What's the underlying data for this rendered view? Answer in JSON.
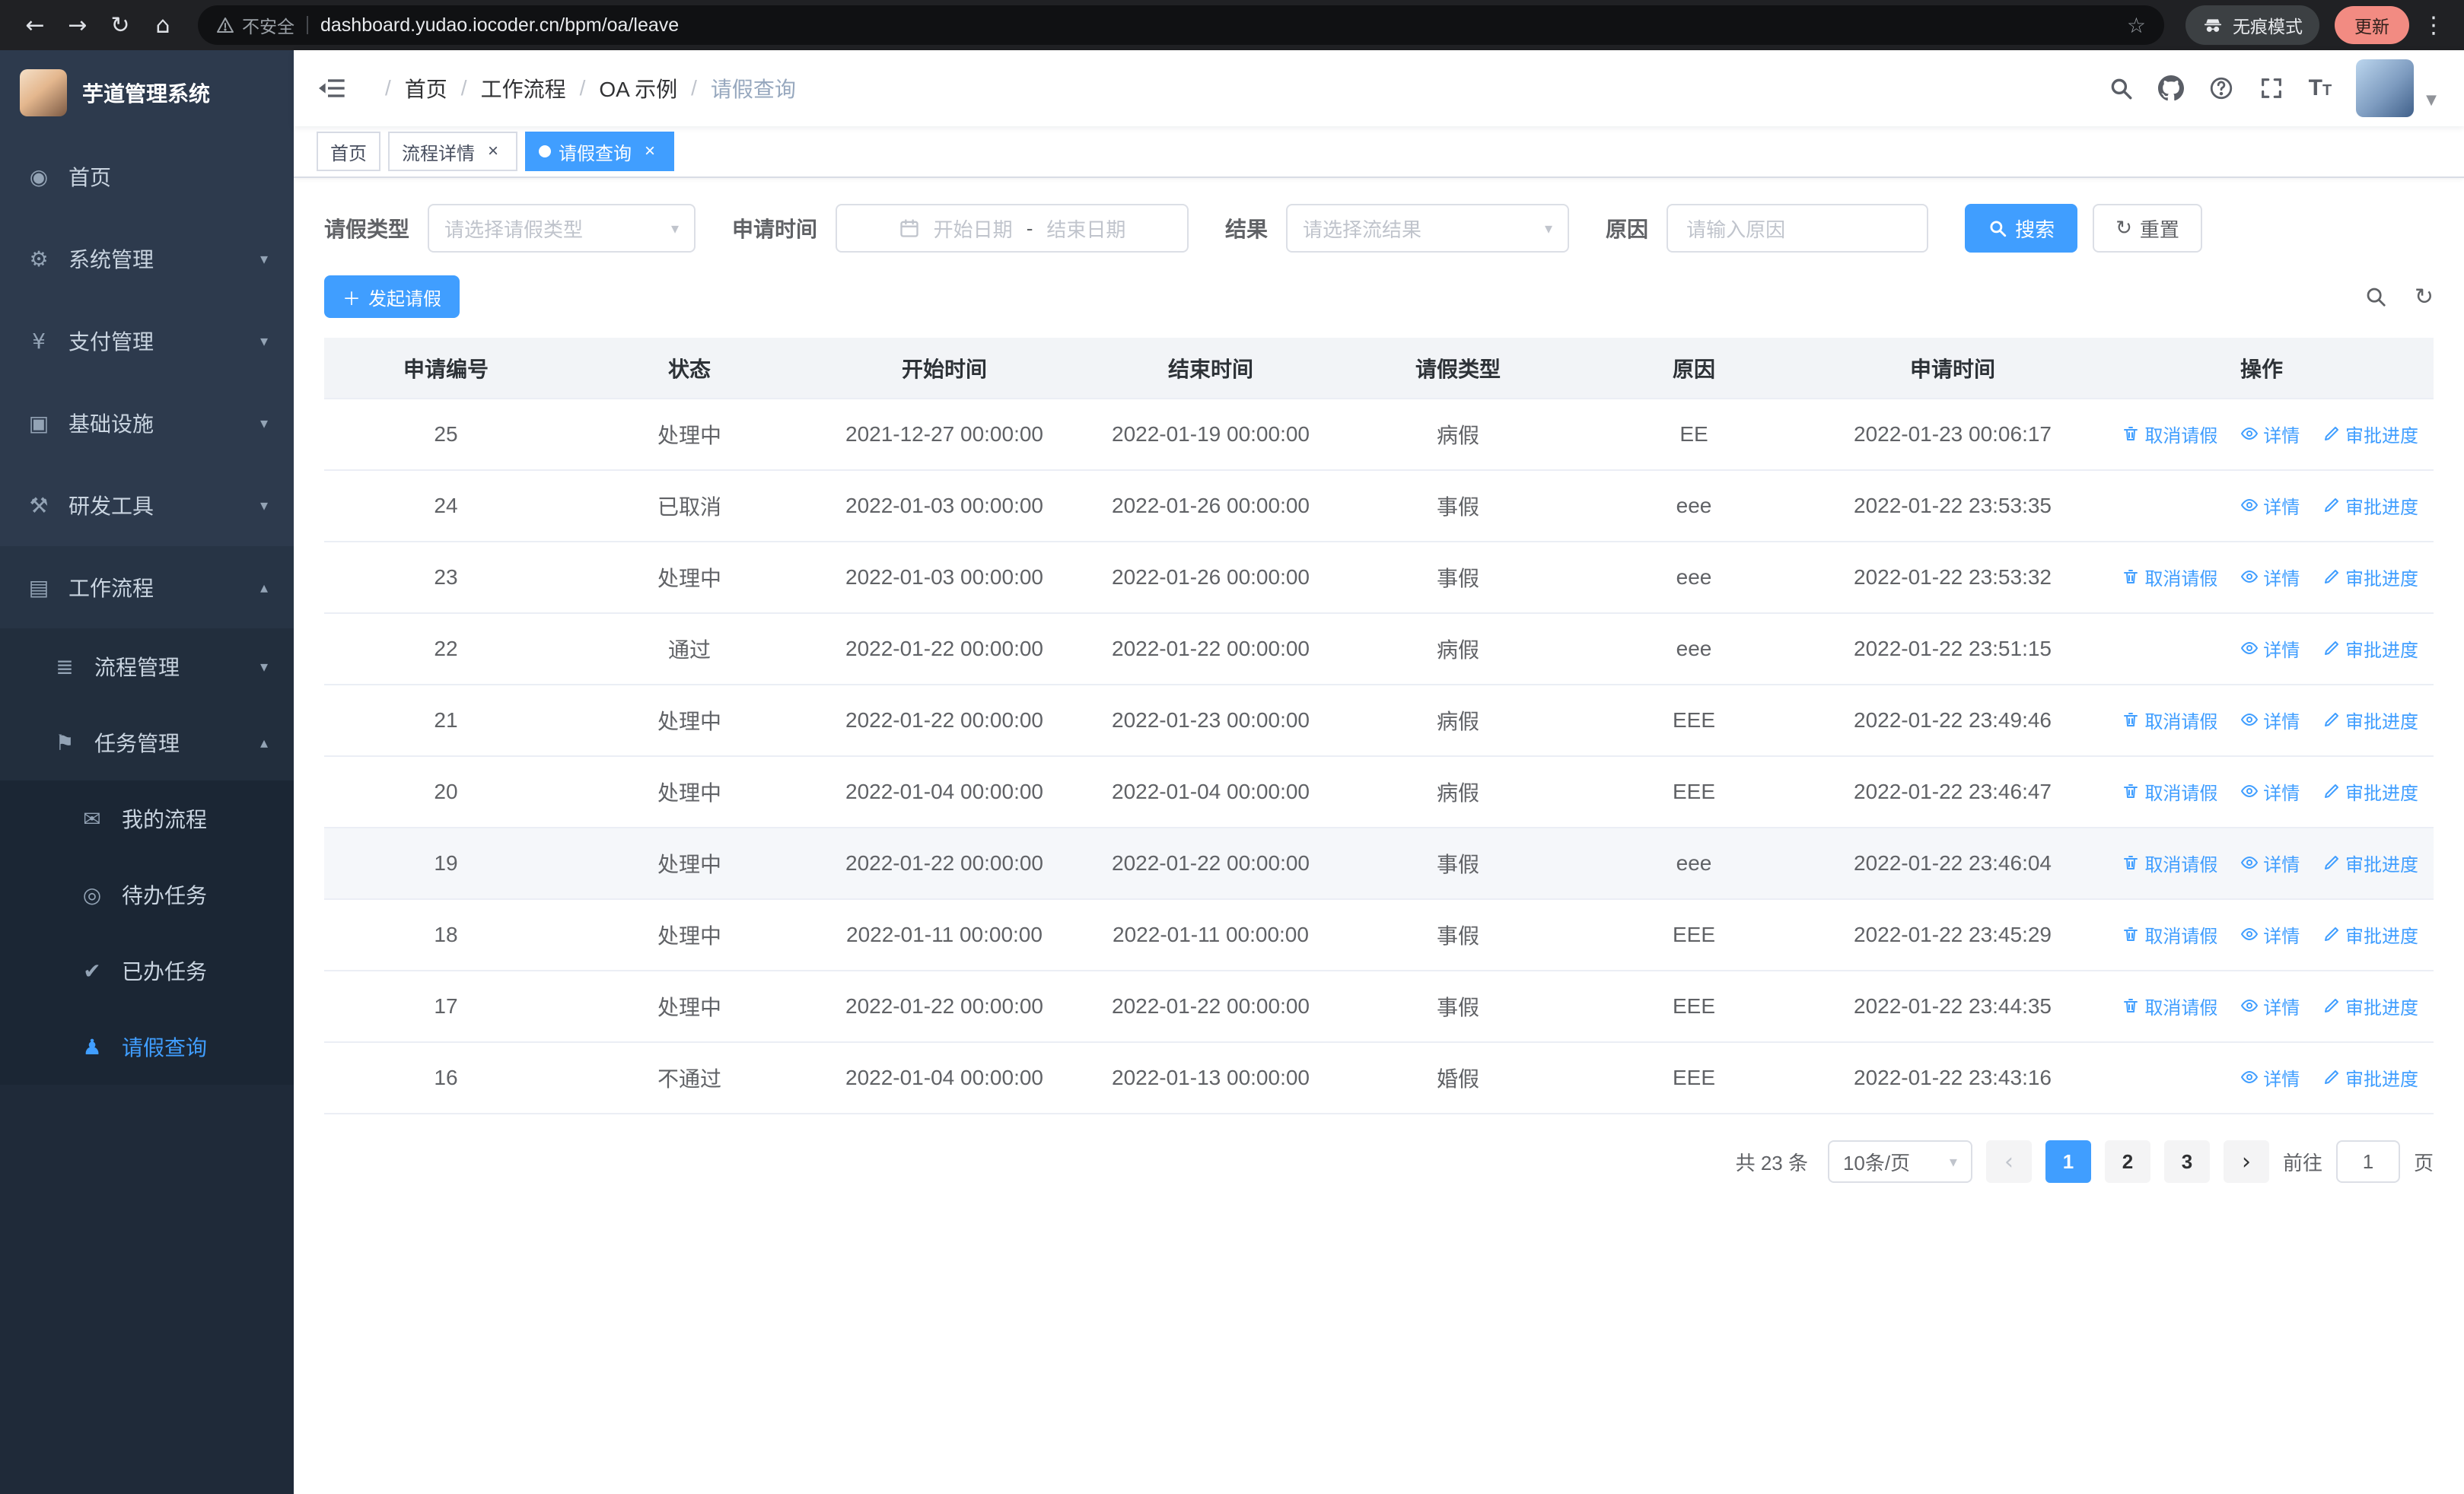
{
  "browser": {
    "security_label": "不安全",
    "url": "dashboard.yudao.iocoder.cn/bpm/oa/leave",
    "incognito_label": "无痕模式",
    "update_label": "更新"
  },
  "sidebar": {
    "logo_title": "芋道管理系统",
    "menu": [
      {
        "label": "首页",
        "icon": "home",
        "level": 1
      },
      {
        "label": "系统管理",
        "icon": "gear",
        "level": 1,
        "arrow": "down"
      },
      {
        "label": "支付管理",
        "icon": "yen",
        "level": 1,
        "arrow": "down"
      },
      {
        "label": "基础设施",
        "icon": "infra",
        "level": 1,
        "arrow": "down"
      },
      {
        "label": "研发工具",
        "icon": "tools",
        "level": 1,
        "arrow": "down"
      },
      {
        "label": "工作流程",
        "icon": "workflow",
        "level": 1,
        "arrow": "up",
        "open": true
      },
      {
        "label": "流程管理",
        "icon": "process",
        "level": 2,
        "arrow": "down"
      },
      {
        "label": "任务管理",
        "icon": "task",
        "level": 2,
        "arrow": "up",
        "open": true
      },
      {
        "label": "我的流程",
        "icon": "my-process",
        "level": 3
      },
      {
        "label": "待办任务",
        "icon": "todo",
        "level": 3
      },
      {
        "label": "已办任务",
        "icon": "done",
        "level": 3
      },
      {
        "label": "请假查询",
        "icon": "leave",
        "level": 3,
        "active": true
      }
    ]
  },
  "header": {
    "breadcrumb": [
      "首页",
      "工作流程",
      "OA 示例",
      "请假查询"
    ],
    "icons": [
      "search",
      "github",
      "help",
      "fullscreen",
      "font-size",
      "avatar"
    ]
  },
  "tabs": [
    {
      "label": "首页"
    },
    {
      "label": "流程详情",
      "closable": true
    },
    {
      "label": "请假查询",
      "closable": true,
      "active": true
    }
  ],
  "filters": {
    "leave_type_label": "请假类型",
    "leave_type_placeholder": "请选择请假类型",
    "apply_time_label": "申请时间",
    "start_date_placeholder": "开始日期",
    "range_separator": "-",
    "end_date_placeholder": "结束日期",
    "result_label": "结果",
    "result_placeholder": "请选择流结果",
    "reason_label": "原因",
    "reason_placeholder": "请输入原因",
    "search_label": "搜索",
    "reset_label": "重置"
  },
  "toolbar": {
    "create_label": "发起请假"
  },
  "table": {
    "columns": [
      "申请编号",
      "状态",
      "开始时间",
      "结束时间",
      "请假类型",
      "原因",
      "申请时间",
      "操作"
    ],
    "actions": {
      "cancel": "取消请假",
      "detail": "详情",
      "progress": "审批进度"
    },
    "rows": [
      {
        "id": "25",
        "status": "处理中",
        "start": "2021-12-27 00:00:00",
        "end": "2022-01-19 00:00:00",
        "type": "病假",
        "reason": "EE",
        "applied": "2022-01-23 00:06:17",
        "cancelable": true
      },
      {
        "id": "24",
        "status": "已取消",
        "start": "2022-01-03 00:00:00",
        "end": "2022-01-26 00:00:00",
        "type": "事假",
        "reason": "eee",
        "applied": "2022-01-22 23:53:35"
      },
      {
        "id": "23",
        "status": "处理中",
        "start": "2022-01-03 00:00:00",
        "end": "2022-01-26 00:00:00",
        "type": "事假",
        "reason": "eee",
        "applied": "2022-01-22 23:53:32",
        "cancelable": true
      },
      {
        "id": "22",
        "status": "通过",
        "start": "2022-01-22 00:00:00",
        "end": "2022-01-22 00:00:00",
        "type": "病假",
        "reason": "eee",
        "applied": "2022-01-22 23:51:15"
      },
      {
        "id": "21",
        "status": "处理中",
        "start": "2022-01-22 00:00:00",
        "end": "2022-01-23 00:00:00",
        "type": "病假",
        "reason": "EEE",
        "applied": "2022-01-22 23:49:46",
        "cancelable": true
      },
      {
        "id": "20",
        "status": "处理中",
        "start": "2022-01-04 00:00:00",
        "end": "2022-01-04 00:00:00",
        "type": "病假",
        "reason": "EEE",
        "applied": "2022-01-22 23:46:47",
        "cancelable": true
      },
      {
        "id": "19",
        "status": "处理中",
        "start": "2022-01-22 00:00:00",
        "end": "2022-01-22 00:00:00",
        "type": "事假",
        "reason": "eee",
        "applied": "2022-01-22 23:46:04",
        "cancelable": true,
        "highlighted": true
      },
      {
        "id": "18",
        "status": "处理中",
        "start": "2022-01-11 00:00:00",
        "end": "2022-01-11 00:00:00",
        "type": "事假",
        "reason": "EEE",
        "applied": "2022-01-22 23:45:29",
        "cancelable": true
      },
      {
        "id": "17",
        "status": "处理中",
        "start": "2022-01-22 00:00:00",
        "end": "2022-01-22 00:00:00",
        "type": "事假",
        "reason": "EEE",
        "applied": "2022-01-22 23:44:35",
        "cancelable": true
      },
      {
        "id": "16",
        "status": "不通过",
        "start": "2022-01-04 00:00:00",
        "end": "2022-01-13 00:00:00",
        "type": "婚假",
        "reason": "EEE",
        "applied": "2022-01-22 23:43:16"
      }
    ]
  },
  "pagination": {
    "total": "共 23 条",
    "page_size": "10条/页",
    "pages": [
      {
        "label": "1",
        "active": true
      },
      {
        "label": "2"
      },
      {
        "label": "3"
      }
    ],
    "goto_label": "前往",
    "goto_value": "1",
    "goto_suffix": "页"
  }
}
